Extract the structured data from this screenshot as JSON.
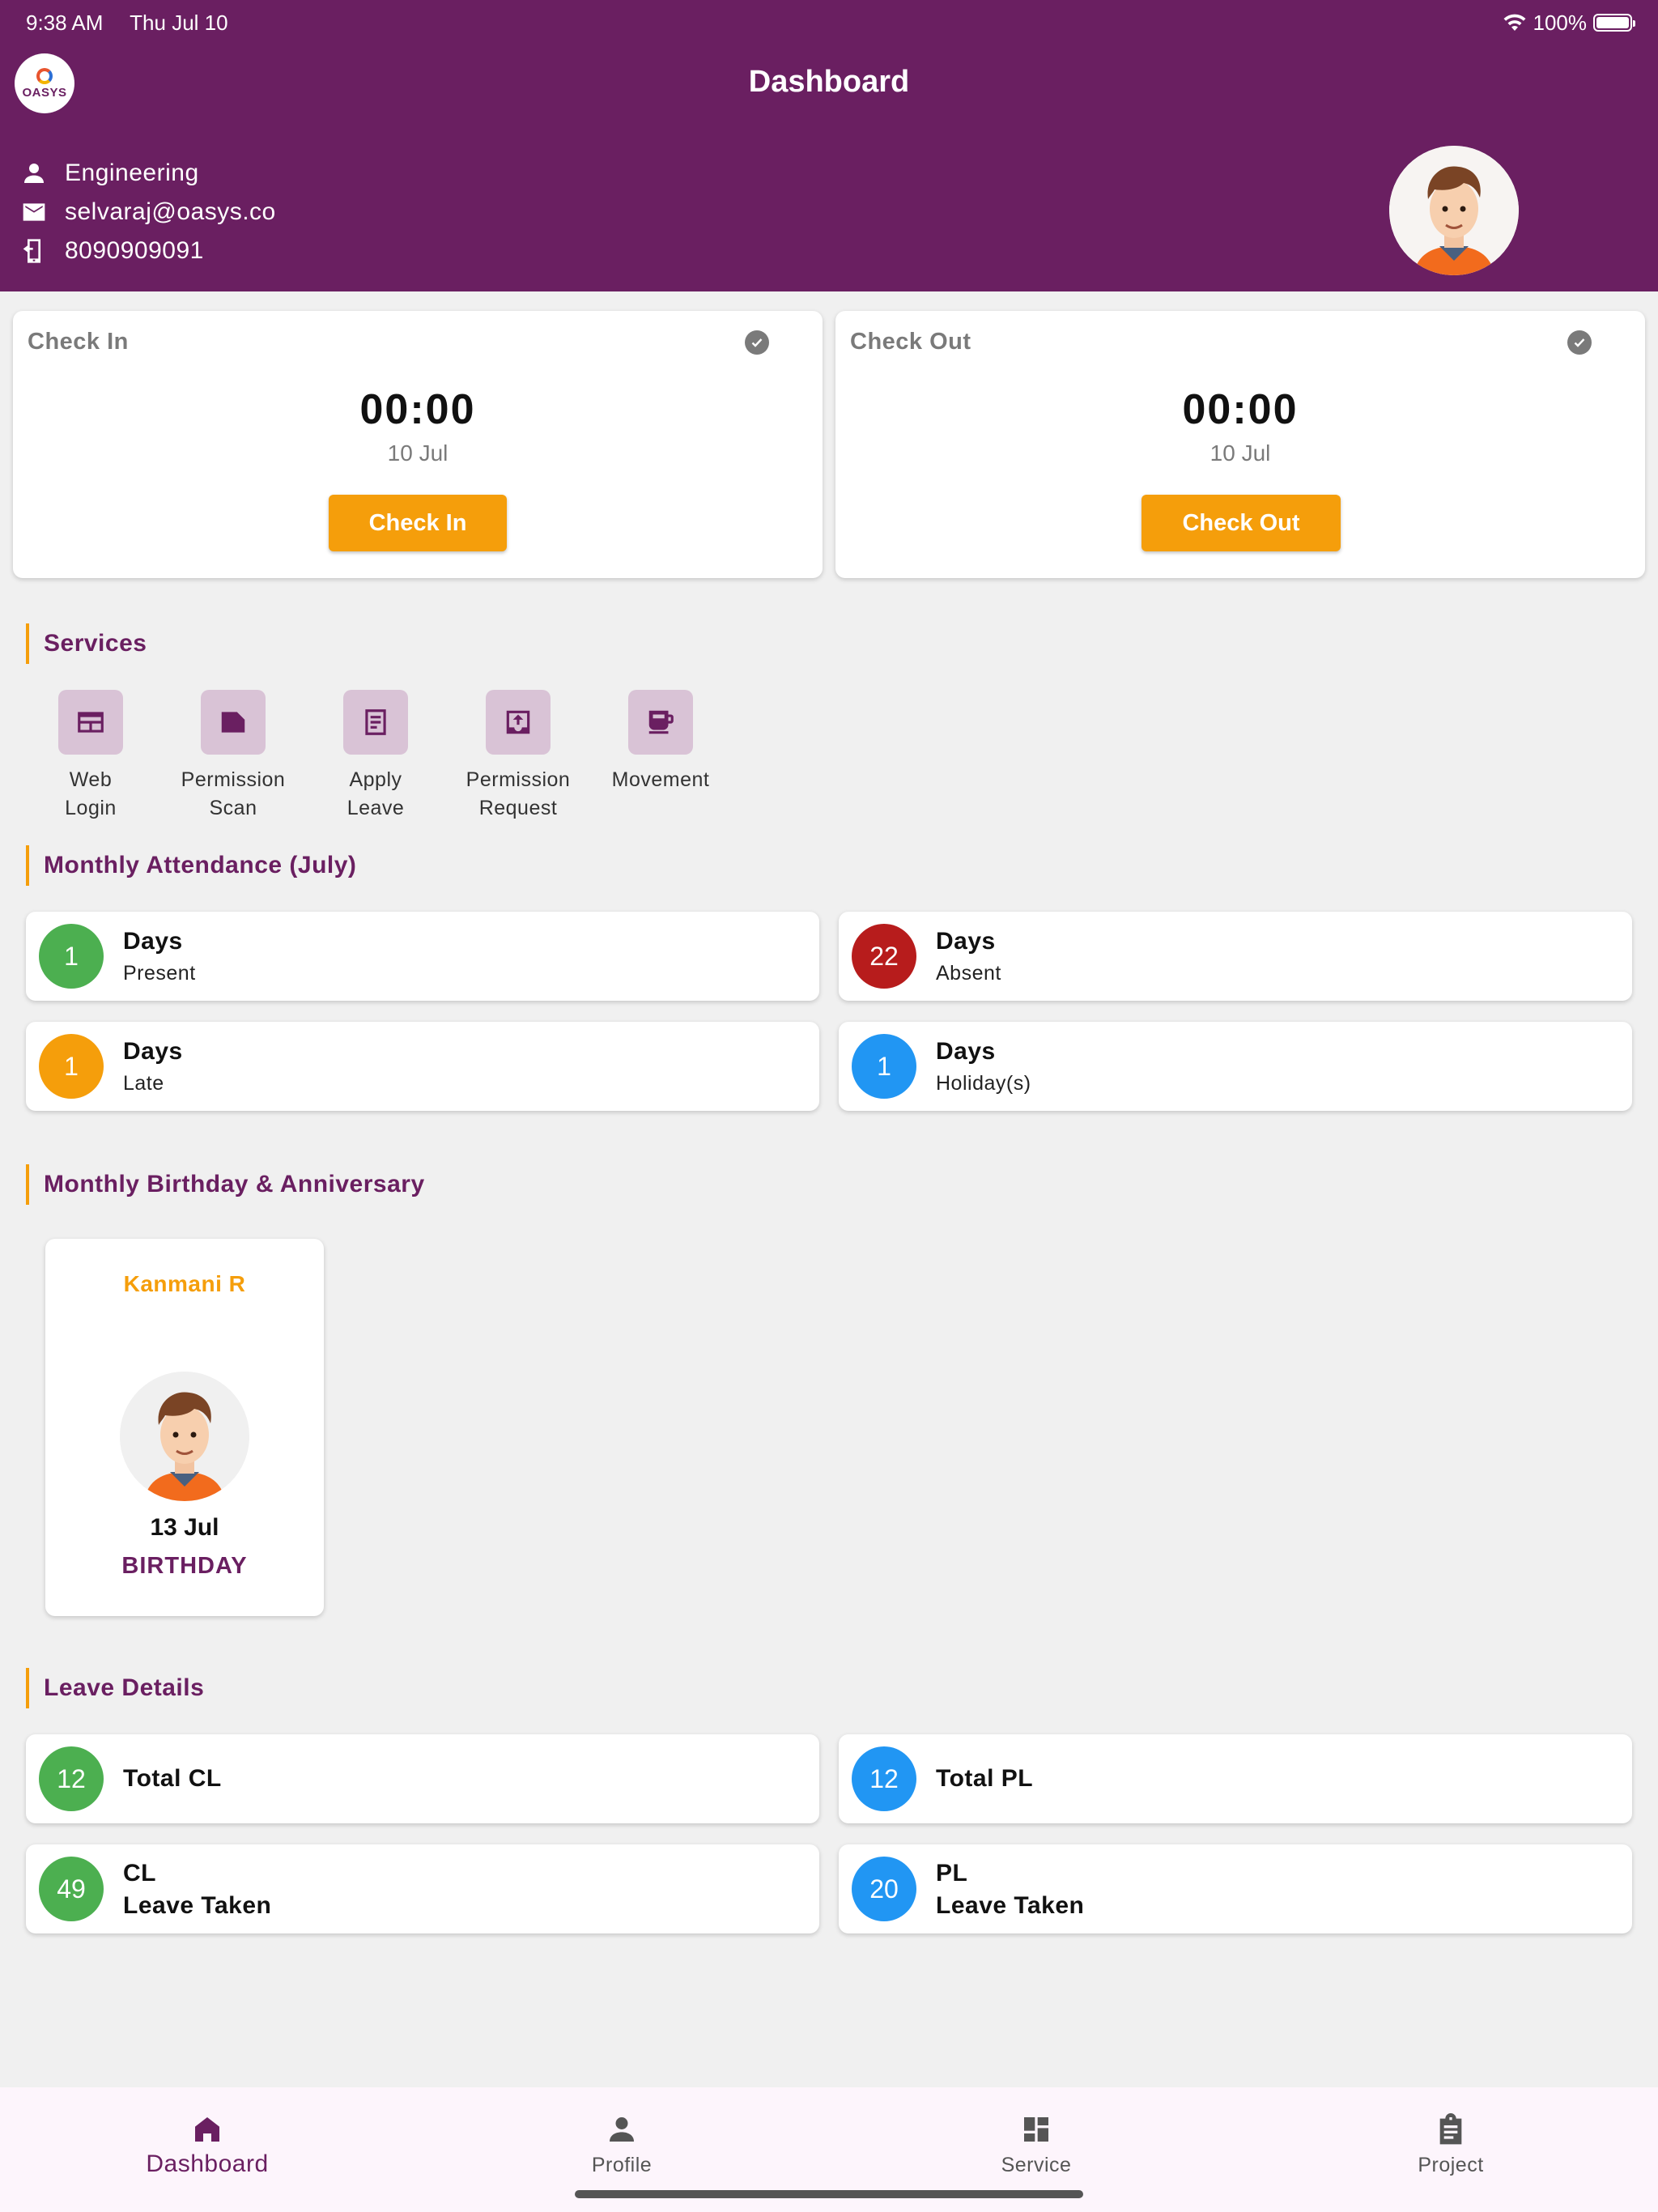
{
  "status_bar": {
    "time": "9:38 AM",
    "date": "Thu Jul 10",
    "battery": "100%"
  },
  "header": {
    "logo_text": "OASYS",
    "title": "Dashboard",
    "department": "Engineering",
    "email": "selvaraj@oasys.co",
    "phone": "8090909091"
  },
  "check_in": {
    "title": "Check In",
    "time": "00:00",
    "date": "10 Jul",
    "button": "Check In"
  },
  "check_out": {
    "title": "Check Out",
    "time": "00:00",
    "date": "10 Jul",
    "button": "Check Out"
  },
  "services": {
    "title": "Services",
    "items": [
      {
        "line1": "Web",
        "line2": "Login",
        "icon": "web-icon"
      },
      {
        "line1": "Permission",
        "line2": "Scan",
        "icon": "folder-icon"
      },
      {
        "line1": "Apply",
        "line2": "Leave",
        "icon": "document-icon"
      },
      {
        "line1": "Permission",
        "line2": "Request",
        "icon": "upload-box-icon"
      },
      {
        "line1": "Movement",
        "line2": "",
        "icon": "coffee-icon"
      }
    ]
  },
  "attendance": {
    "title": "Monthly Attendance (July)",
    "items": [
      {
        "count": "1",
        "label": "Days",
        "sub": "Present",
        "color": "#4caf50"
      },
      {
        "count": "22",
        "label": "Days",
        "sub": "Absent",
        "color": "#b71c1c"
      },
      {
        "count": "1",
        "label": "Days",
        "sub": "Late",
        "color": "#f59e0b"
      },
      {
        "count": "1",
        "label": "Days",
        "sub": "Holiday(s)",
        "color": "#2196f3"
      }
    ]
  },
  "birthday": {
    "title": "Monthly Birthday & Anniversary",
    "cards": [
      {
        "name": "Kanmani R",
        "date": "13 Jul",
        "kind": "BIRTHDAY"
      }
    ]
  },
  "leave": {
    "title": "Leave Details",
    "items": [
      {
        "count": "12",
        "label": "Total CL",
        "color": "#4caf50"
      },
      {
        "count": "12",
        "label": "Total PL",
        "color": "#2196f3"
      },
      {
        "count": "49",
        "line1": "CL",
        "line2": "Leave Taken",
        "color": "#4caf50"
      },
      {
        "count": "20",
        "line1": "PL",
        "line2": "Leave Taken",
        "color": "#2196f3"
      }
    ]
  },
  "nav": {
    "items": [
      {
        "label": "Dashboard",
        "icon": "home-icon",
        "active": true
      },
      {
        "label": "Profile",
        "icon": "person-icon"
      },
      {
        "label": "Service",
        "icon": "grid-icon"
      },
      {
        "label": "Project",
        "icon": "clipboard-icon"
      }
    ]
  },
  "colors": {
    "primary": "#6a1f61",
    "accent": "#f59e0b"
  }
}
